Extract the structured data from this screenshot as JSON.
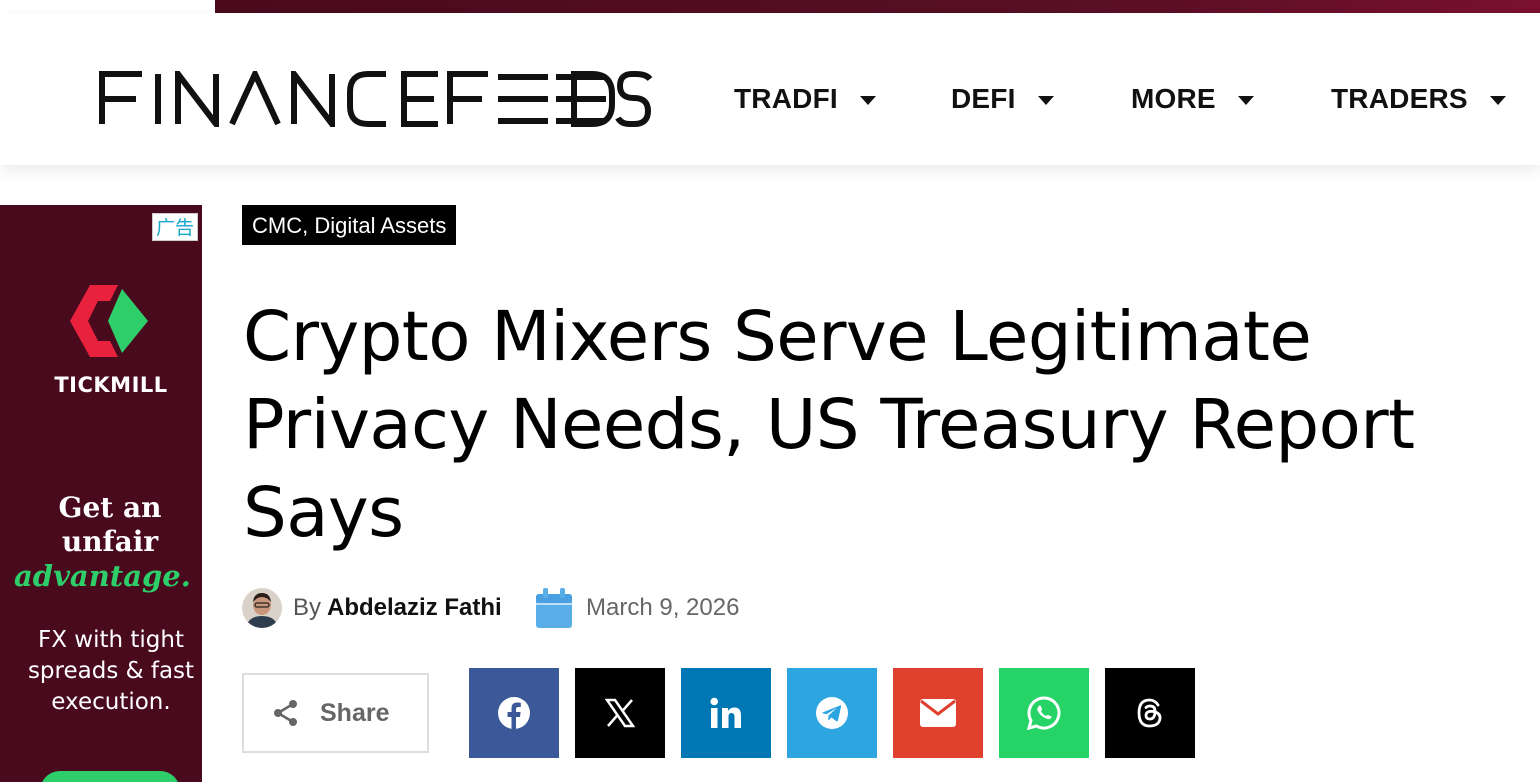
{
  "header": {
    "logo_text": "FINANCEFEEDS",
    "nav": [
      {
        "label": "TRADFI"
      },
      {
        "label": "DEFI"
      },
      {
        "label": "MORE"
      },
      {
        "label": "TRADERS"
      }
    ]
  },
  "ad": {
    "tag": "广告",
    "brand": "TICKMILL",
    "headline_line1": "Get an",
    "headline_line2": "unfair",
    "headline_accent": "advantage.",
    "sub_line1": "FX with tight",
    "sub_line2": "spreads & fast",
    "sub_line3": "execution.",
    "colors": {
      "background": "#4a0a1e",
      "accent": "#2ecf6a",
      "logo_red": "#e8213c"
    }
  },
  "article": {
    "category": "CMC, Digital Assets",
    "title_line1": "Crypto Mixers Serve Legitimate",
    "title_line2": "Privacy Needs, US Treasury Report",
    "title_line3": "Says",
    "by_prefix": "By",
    "author": "Abdelaziz Fathi",
    "date": "March 9, 2026"
  },
  "share": {
    "label": "Share",
    "buttons": [
      {
        "name": "facebook",
        "icon": "facebook-icon",
        "color": "#3b5998"
      },
      {
        "name": "x",
        "icon": "x-icon",
        "color": "#000000"
      },
      {
        "name": "linkedin",
        "icon": "linkedin-icon",
        "color": "#0077b5"
      },
      {
        "name": "telegram",
        "icon": "telegram-icon",
        "color": "#2ca5e0"
      },
      {
        "name": "email",
        "icon": "email-icon",
        "color": "#e0412f"
      },
      {
        "name": "whatsapp",
        "icon": "whatsapp-icon",
        "color": "#25d366"
      },
      {
        "name": "threads",
        "icon": "threads-icon",
        "color": "#000000"
      }
    ]
  }
}
